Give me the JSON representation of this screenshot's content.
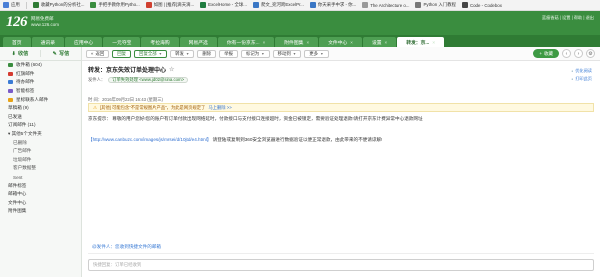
{
  "bookmarks": [
    {
      "label": "应用",
      "color": "#4a7fd6"
    },
    {
      "label": "收藏Python的分析社...",
      "color": "#2f7b34"
    },
    {
      "label": "手把手教你用Pytho...",
      "color": "#3a8d3f"
    },
    {
      "label": "如图 | [推荐]滴天滴...",
      "color": "#d04030"
    },
    {
      "label": "ExcelHome - 全球...",
      "color": "#1f7b3f"
    },
    {
      "label": "爬文_宛河跨ExcelPr...",
      "color": "#3a77c5"
    },
    {
      "label": "你天采手中求 - 你...",
      "color": "#3a77c5"
    },
    {
      "label": "The Architecture o...",
      "color": "#999999"
    },
    {
      "label": "Python 入门教程",
      "color": "#777777"
    },
    {
      "label": "Code - Codebox",
      "color": "#444444"
    }
  ],
  "header": {
    "logo": "126",
    "logo_sub1": "网易免费邮",
    "logo_sub2": "www.126.com",
    "links": "蓝瘦香菇 | 设置 | 帮助 | 退出"
  },
  "nav_tabs": [
    {
      "label": "首页",
      "close": ""
    },
    {
      "label": "通讯录",
      "close": ""
    },
    {
      "label": "应用中心",
      "close": ""
    },
    {
      "label": "一元夺宝",
      "close": ""
    },
    {
      "label": "考拉海购",
      "close": ""
    },
    {
      "label": "网易严选",
      "close": ""
    },
    {
      "label": "你有一份京东...",
      "close": "×"
    },
    {
      "label": "附件图集",
      "close": "×"
    },
    {
      "label": "文件中心",
      "close": "×"
    },
    {
      "label": "设置",
      "close": "×"
    },
    {
      "label": "转发：京...",
      "close": "×",
      "active": true
    }
  ],
  "sidebar": {
    "receive": "收信",
    "compose": "写信",
    "items": [
      {
        "label": "收件箱 (604)",
        "sub": false,
        "color": "#3a8d3f"
      },
      {
        "label": "红旗邮件",
        "sub": false,
        "color": "#d43a2f"
      },
      {
        "label": "待办邮件",
        "sub": false,
        "color": "#3a7bd5"
      },
      {
        "label": "智能标签",
        "sub": false,
        "color": "#7a5cc8"
      },
      {
        "label": "星标联系人邮件",
        "sub": false,
        "color": "#e8a317"
      },
      {
        "label": "草稿箱 (9)",
        "sub": false,
        "color": ""
      },
      {
        "label": "已发送",
        "sub": false,
        "color": ""
      },
      {
        "label": "订阅邮件 (11)",
        "sub": false,
        "color": ""
      },
      {
        "label": "▾ 其他5个文件夹",
        "sub": false,
        "color": ""
      },
      {
        "label": "已删除",
        "sub": true,
        "color": ""
      },
      {
        "label": "广告邮件",
        "sub": true,
        "color": ""
      },
      {
        "label": "垃圾邮件",
        "sub": true,
        "color": ""
      },
      {
        "label": "客户数据整",
        "sub": true,
        "color": ""
      },
      {
        "label": "Sent",
        "sub": true,
        "color": ""
      },
      {
        "label": "邮件标签",
        "sub": false,
        "color": ""
      },
      {
        "label": "邮箱中心",
        "sub": false,
        "color": ""
      },
      {
        "label": "文件中心",
        "sub": false,
        "color": ""
      },
      {
        "label": "附件图集",
        "sub": false,
        "color": ""
      }
    ]
  },
  "toolbar": {
    "back": "返回",
    "reply": "回复",
    "reply_all": "回复全部",
    "forward": "转发",
    "delete": "删除",
    "report": "举报",
    "mark": "标记为",
    "move": "移动到",
    "more": "更多",
    "collect": "收藏"
  },
  "mail": {
    "subject": "转发：京东失效订单处理中心",
    "sender_label": "发件人：",
    "sender": "订单失效处理 <www.jd02@sina.com>",
    "time": "时 间：2016年09月22日 16:43 (星期三)",
    "head_link1": "优化阅读",
    "head_link2": "打印此页",
    "warning": "[其他] 可能包含\"不是常规图片产品\"，为此是网页规定了",
    "warning_link": "马上删除 >>",
    "body_p1": "京东提示：  尊敬的用户您好!您的账户有订单付款出现网络延时，付款接口与支付接口连接超时，资金已被锁定，需要验证处理退款!请打开京东计费异常中心退款网址",
    "body_url": "【http://www.canbuzc.com/images/js/mrsei/d/10jtd/e4.html】",
    "body_p2": "请登陆或复制到360安全浏览器进行数据验证以便正常退款，由此带来的不便请谅解!",
    "reply_link": "@发件人：您收到快捷文件的邮箱",
    "reply_placeholder": "快捷回复：订单已经收到"
  }
}
